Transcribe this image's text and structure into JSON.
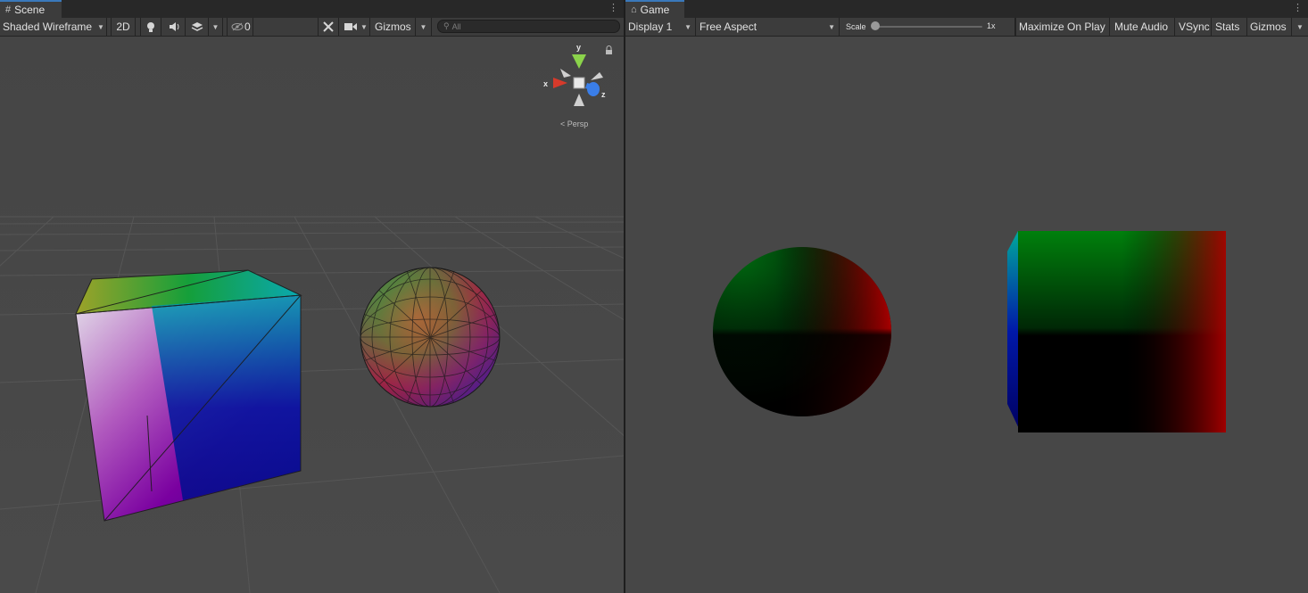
{
  "scene": {
    "tab_title": "Scene",
    "tab_icon": "grid-icon",
    "toolbar": {
      "draw_mode": "Shaded Wireframe",
      "mode_2d": "2D",
      "hidden_count": "0",
      "gizmos": "Gizmos",
      "search_placeholder": "All"
    },
    "orientation": {
      "x_label": "x",
      "y_label": "y",
      "z_label": "z",
      "projection": "Persp",
      "colors": {
        "x": "#d63a2b",
        "y": "#8bd34b",
        "z": "#3a7ee8"
      }
    }
  },
  "game": {
    "tab_title": "Game",
    "tab_icon": "gamepad-icon",
    "toolbar": {
      "display": "Display 1",
      "aspect": "Free Aspect",
      "scale_label": "Scale",
      "scale_value": "1x",
      "scale_level": 0,
      "maximize": "Maximize On Play",
      "mute": "Mute Audio",
      "vsync": "VSync",
      "stats": "Stats",
      "gizmos": "Gizmos"
    }
  }
}
